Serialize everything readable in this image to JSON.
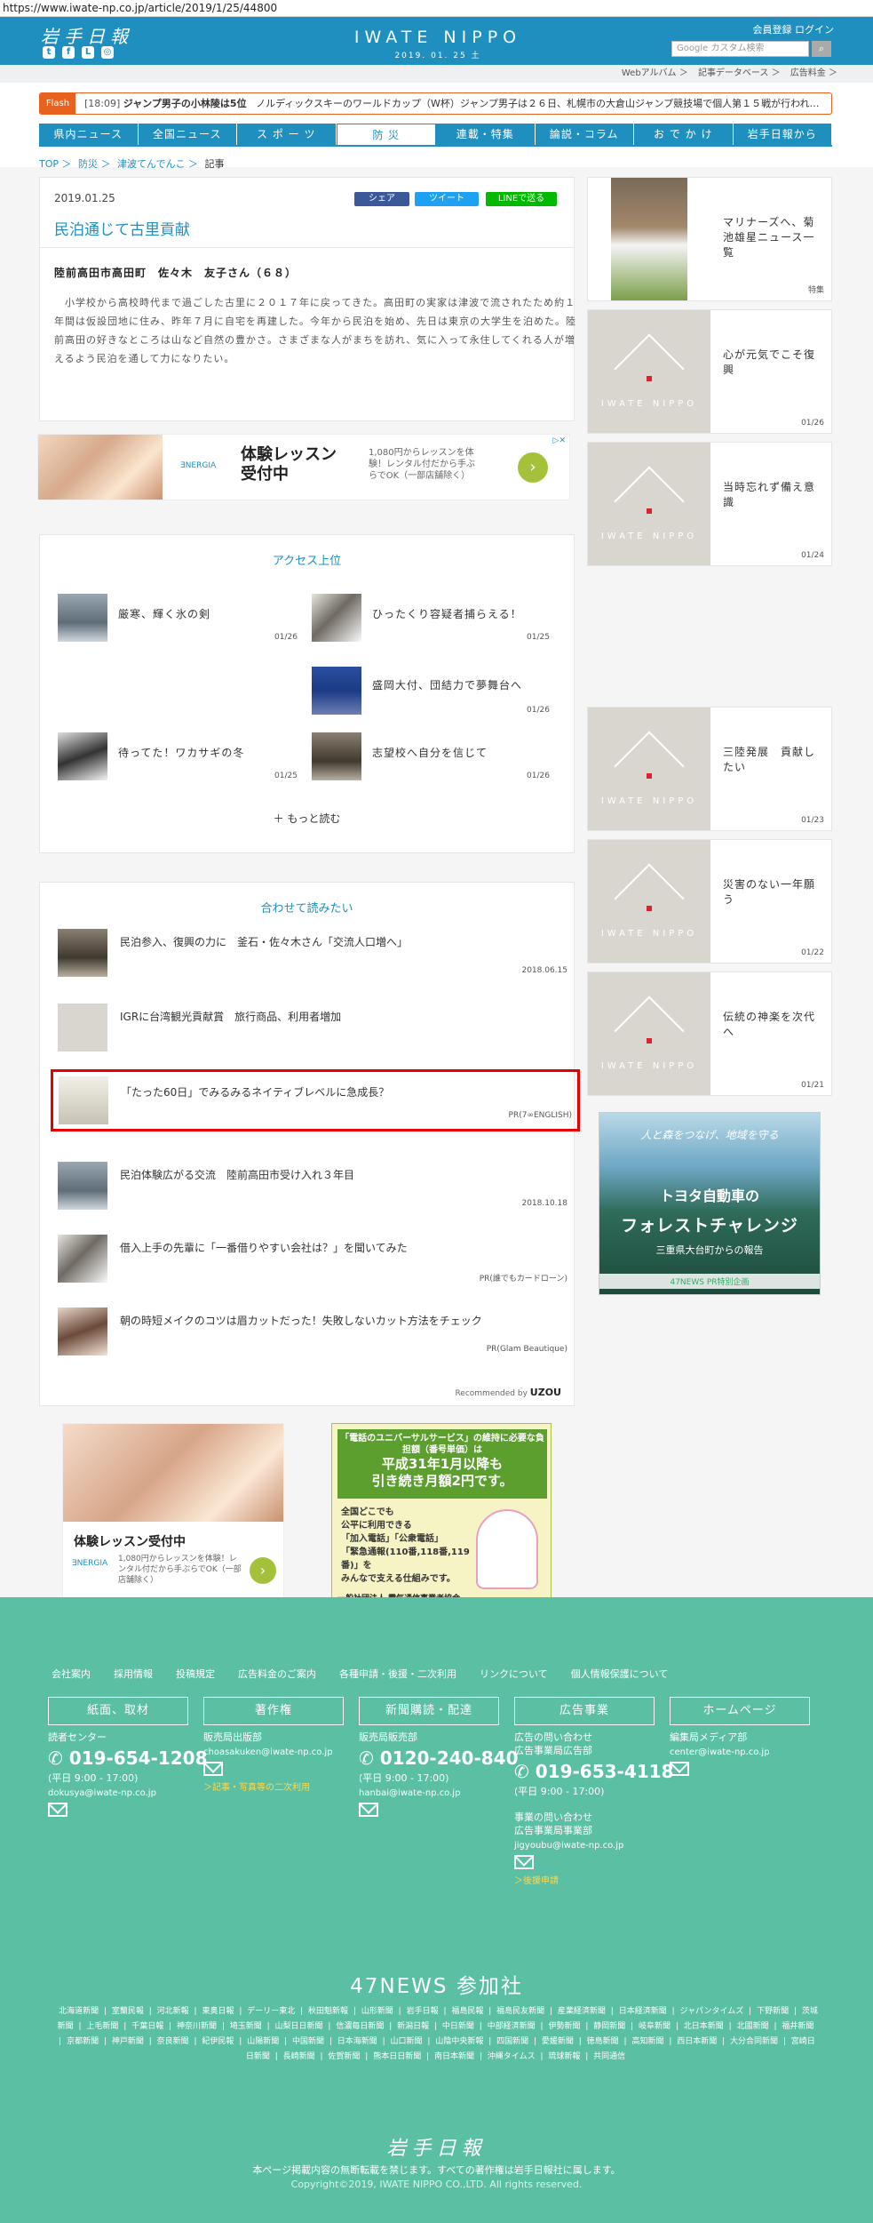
{
  "browser": {
    "url": "https://www.iwate-np.co.jp/article/2019/1/25/44800"
  },
  "header": {
    "logo_jp": "岩手日報",
    "brand": "IWATE NIPPO",
    "date_line": "2019. 01. 25  土",
    "member_links": "会員登録  ログイン",
    "search_placeholder": "Google カスタム検索",
    "social_icons": [
      "twitter-icon",
      "facebook-icon",
      "line-icon",
      "instagram-icon"
    ]
  },
  "subbar": {
    "items": [
      "Webアルバム ＞",
      "記事データベース ＞",
      "広告料金 ＞"
    ]
  },
  "flash": {
    "badge": "Flash",
    "time": "[18:09]",
    "headline": "ジャンプ男子の小林陵は5位",
    "body": "ノルディックスキーのワールドカップ（W杯）ジャンプ男子は２６日、札幌市の大倉山ジャンプ競技場で個人第１５戦が行われ…"
  },
  "nav": {
    "items": [
      "県内ニュース",
      "全国ニュース",
      "ス ポ ー ツ",
      "防  災",
      "連載・特集",
      "論説・コラム",
      "お で か け",
      "岩手日報から"
    ],
    "active_index": 3
  },
  "breadcrumb": {
    "items": [
      "TOP ＞",
      "防災 ＞",
      "津波てんでんこ ＞"
    ],
    "current": "記事"
  },
  "article": {
    "date": "2019.01.25",
    "share": {
      "facebook": "シェア",
      "twitter": "ツイート",
      "line": "LINEで送る"
    },
    "title": "民泊通じて古里貢献",
    "who": "陸前高田市高田町　佐々木　友子さん（６８）",
    "body": "　小学校から高校時代まで過ごした古里に２０１７年に戻ってきた。高田町の実家は津波で流されたため約１年間は仮設団地に住み、昨年７月に自宅を再建した。今年から民泊を始め、先日は東京の大学生を泊めた。陸前高田の好きなところは山など自然の豊かさ。さまざまな人がまちを訪れ、気に入って永住してくれる人が増えるよう民泊を通して力になりたい。"
  },
  "ad_banner": {
    "logo": "ƎNERGIA",
    "title": "体験レッスン\n受付中",
    "desc": "1,080円からレッスンを体験！レンタル付だから手ぶらでOK（一部店舗除く）",
    "cta": "›",
    "adchoice": "▷✕"
  },
  "access": {
    "title": "アクセス上位",
    "items": [
      {
        "title": "厳寒、輝く氷の剣",
        "date": "01/26"
      },
      {
        "title": "ひったくり容疑者捕らえる！",
        "date": "01/25"
      },
      {
        "title": "盛岡大付、団結力で夢舞台へ",
        "date": "01/26"
      },
      {
        "title": "待ってた！ワカサギの冬",
        "date": "01/25"
      },
      {
        "title": "志望校へ自分を信じて",
        "date": "01/26"
      }
    ],
    "more": "＋ もっと読む"
  },
  "related": {
    "title": "合わせて読みたい",
    "items": [
      {
        "title": "民泊参入、復興の力に　釜石・佐々木さん「交流人口増へ」",
        "meta": "2018.06.15"
      },
      {
        "title": "IGRに台湾観光貢献賞　旅行商品、利用者増加",
        "meta": ""
      },
      {
        "title": "「たった60日」でみるみるネイティブレベルに急成長？",
        "meta": "PR(7∞ENGLISH)"
      },
      {
        "title": "民泊体験広がる交流　陸前高田市受け入れ３年目",
        "meta": "2018.10.18"
      },
      {
        "title": "借入上手の先輩に「一番借りやすい会社は？」を聞いてみた",
        "meta": "PR(誰でもカードローン)"
      },
      {
        "title": "朝の時短メイクのコツは眉カットだった！失敗しないカット方法をチェック",
        "meta": "PR(Glam Beautique)"
      }
    ],
    "recommended_by": "Recommended by",
    "rec_brand": "UZOU"
  },
  "sidebar": {
    "cards": [
      {
        "title": "マリナーズへ、菊池雄星ニュース一覧",
        "date": "特集"
      },
      {
        "title": "心が元気でこそ復興",
        "date": "01/26"
      },
      {
        "title": "当時忘れず備え意識",
        "date": "01/24"
      },
      {
        "title": "三陸発展　貢献したい",
        "date": "01/23"
      },
      {
        "title": "災害のない一年願う",
        "date": "01/22"
      },
      {
        "title": "伝統の神楽を次代へ",
        "date": "01/21"
      }
    ],
    "placeholder_logo": "IWATE NIPPO"
  },
  "toyota_ad": {
    "tagline": "人と森をつなげ、地域を守る",
    "brand": "トヨタ自動車の",
    "title": "フォレストチャレンジ",
    "sub": "三重県大台町からの報告",
    "foot": "47NEWS PR特別企画"
  },
  "ad2": {
    "title": "体験レッスン受付中",
    "desc": "1,080円からレッスンを体験！レンタル付だから手ぶらでOK（一部店舗除く）",
    "logo": "ƎNERGIA",
    "cta": "›"
  },
  "ad3": {
    "top": "「電話のユニバーサルサービス」の維持に必要な負担額（番号単価）は",
    "big": "平成31年1月以降も\n引き続き月額2円です。",
    "body": "全国どこでも\n公平に利用できる\n「加入電話」「公衆電話」\n「緊急通報(110番,118番,119番)」を\nみんなで支える仕組みです。",
    "foot": "一般社団法人 電気通信事業者協会"
  },
  "footer": {
    "links": [
      "会社案内",
      "採用情報",
      "投稿規定",
      "広告料金のご案内",
      "各種申請・後援・二次利用",
      "リンクについて",
      "個人情報保護について"
    ],
    "cols": [
      {
        "box": "紙面、取材",
        "sub": "読者センター",
        "phone": "019-654-1208",
        "hours": "(平日 9:00 - 17:00)",
        "mail": "dokusya@iwate-np.co.jp",
        "extra": ""
      },
      {
        "box": "著作権",
        "sub": "販売局出版部",
        "phone": "",
        "hours": "",
        "mail": "choasakuken@iwate-np.co.jp",
        "extra": "＞記事・写真等の二次利用"
      },
      {
        "box": "新聞購読・配達",
        "sub": "販売局販売部",
        "phone": "0120-240-840",
        "hours": "(平日 9:00 - 17:00)",
        "mail": "hanbai@iwate-np.co.jp",
        "extra": ""
      },
      {
        "box": "広告事業",
        "sub": "広告の問い合わせ\n広告事業局広告部",
        "phone": "019-653-4118",
        "hours": "(平日 9:00 - 17:00)",
        "mail": "",
        "extra": ""
      },
      {
        "box": "ホームページ",
        "sub": "編集局メディア部",
        "phone": "",
        "hours": "",
        "mail": "center@iwate-np.co.jp",
        "extra": ""
      }
    ],
    "col4_event": "事業の問い合わせ\n広告事業局事業部",
    "col4_mail": "jigyoubu@iwate-np.co.jp",
    "col4_link": "＞後援申請",
    "n47_title": "47NEWS 参加社",
    "papers": [
      "北海道新聞",
      "室蘭民報",
      "河北新報",
      "東奥日報",
      "デーリー東北",
      "秋田魁新報",
      "山形新聞",
      "岩手日報",
      "福島民報",
      "福島民友新聞",
      "産業経済新聞",
      "日本経済新聞",
      "ジャパンタイムズ",
      "下野新聞",
      "茨城新聞",
      "上毛新聞",
      "千葉日報",
      "神奈川新聞",
      "埼玉新聞",
      "山梨日日新聞",
      "信濃毎日新聞",
      "新潟日報",
      "中日新聞",
      "中部経済新聞",
      "伊勢新聞",
      "静岡新聞",
      "岐阜新聞",
      "北日本新聞",
      "北國新聞",
      "福井新聞",
      "京都新聞",
      "神戸新聞",
      "奈良新聞",
      "紀伊民報",
      "山陽新聞",
      "中国新聞",
      "日本海新聞",
      "山口新聞",
      "山陰中央新報",
      "四国新聞",
      "愛媛新聞",
      "徳島新聞",
      "高知新聞",
      "西日本新聞",
      "大分合同新聞",
      "宮崎日日新聞",
      "長崎新聞",
      "佐賀新聞",
      "熊本日日新聞",
      "南日本新聞",
      "沖縄タイムス",
      "琉球新報",
      "共同通信"
    ],
    "logo": "岩手日報",
    "copy1": "本ページ掲載内容の無断転載を禁じます。すべての著作権は岩手日報社に属します。",
    "copy2": "Copyright©2019, IWATE NIPPO CO.,LTD. All rights reserved."
  }
}
